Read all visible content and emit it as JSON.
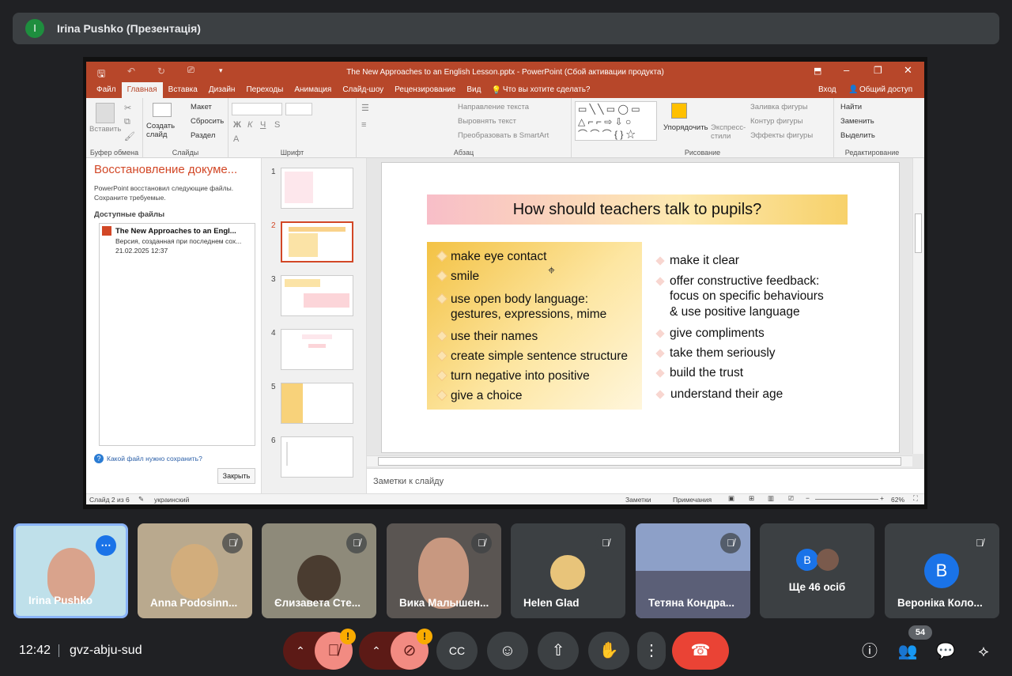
{
  "presenter": {
    "initial": "I",
    "label": "Irina Pushko (Презентація)"
  },
  "powerpoint": {
    "title": "The New Approaches to an English Lesson.pptx - PowerPoint (Сбой активации продукта)",
    "tabs": [
      "Файл",
      "Главная",
      "Вставка",
      "Дизайн",
      "Переходы",
      "Анимация",
      "Слайд-шоу",
      "Рецензирование",
      "Вид"
    ],
    "tell_me": "Что вы хотите сделать?",
    "sign_in": "Вход",
    "share": "Общий доступ",
    "ribbon": {
      "paste": "Вставить",
      "clipboard": "Буфер обмена",
      "new_slide": "Создать слайд",
      "layout": "Макет",
      "reset": "Сбросить",
      "section": "Раздел",
      "slides": "Слайды",
      "font": "Шрифт",
      "text_direction": "Направление текста",
      "align_text": "Выровнять текст",
      "smartart": "Преобразовать в SmartArt",
      "paragraph": "Абзац",
      "arrange": "Упорядочить",
      "quick_styles": "Экспресс-стили",
      "fill": "Заливка фигуры",
      "outline": "Контур фигуры",
      "effects": "Эффекты фигуры",
      "drawing": "Рисование",
      "find": "Найти",
      "replace": "Заменить",
      "select": "Выделить",
      "editing": "Редактирование"
    },
    "recovery": {
      "title": "Восстановление докуме...",
      "desc": "PowerPoint восстановил следующие файлы. Сохраните требуемые.",
      "available": "Доступные файлы",
      "file_name": "The New Approaches to an Engl...",
      "file_version": "Версия, созданная при последнем сох...",
      "file_date": "21.02.2025 12:37",
      "help": "Какой файл нужно сохранить?",
      "close": "Закрыть"
    },
    "thumb_numbers": [
      "1",
      "2",
      "3",
      "4",
      "5",
      "6"
    ],
    "slide": {
      "title": "How should teachers talk to pupils?",
      "left_items": [
        "make eye contact",
        "smile",
        "use open body language:",
        "gestures, expressions, mime",
        "use their names",
        "create simple sentence structure",
        "turn negative into positive",
        "give a choice"
      ],
      "right_items": [
        "make it clear",
        "offer constructive feedback:",
        "focus  on  specific  behaviours",
        "& use positive language",
        "give compliments",
        "take them seriously",
        "build the trust",
        "understand their age"
      ]
    },
    "notes_placeholder": "Заметки к слайду",
    "status": {
      "slide": "Слайд 2 из 6",
      "lang": "украинский",
      "notes": "Заметки",
      "comments": "Примечания",
      "zoom": "62%"
    }
  },
  "participants": [
    {
      "name": "Irina Pushko",
      "photo_bg": "#bfe0ea"
    },
    {
      "name": "Anna Podosinn...",
      "photo_bg": "#b9a98e"
    },
    {
      "name": "Єлизавета Сте...",
      "photo_bg": "#8e8a7a"
    },
    {
      "name": "Вика Малышен...",
      "photo_bg": "#5a5552"
    },
    {
      "name": "Helen Glad",
      "photo_bg": "#3c4043"
    },
    {
      "name": "Тетяна Кондра...",
      "photo_bg": "#8da0c8"
    },
    {
      "name": "Ще 46 осіб",
      "photo_bg": "#3c4043"
    },
    {
      "name": "Вероніка Коло...",
      "photo_bg": "#3c4043"
    }
  ],
  "avatar_letters": {
    "more": "B",
    "veronika": "B"
  },
  "meeting": {
    "time": "12:42",
    "code": "gvz-abju-sud",
    "people_count": "54"
  },
  "colors": {
    "end_call": "#ea4335",
    "warning": "#f9ab00",
    "muted": "#f28b82"
  }
}
